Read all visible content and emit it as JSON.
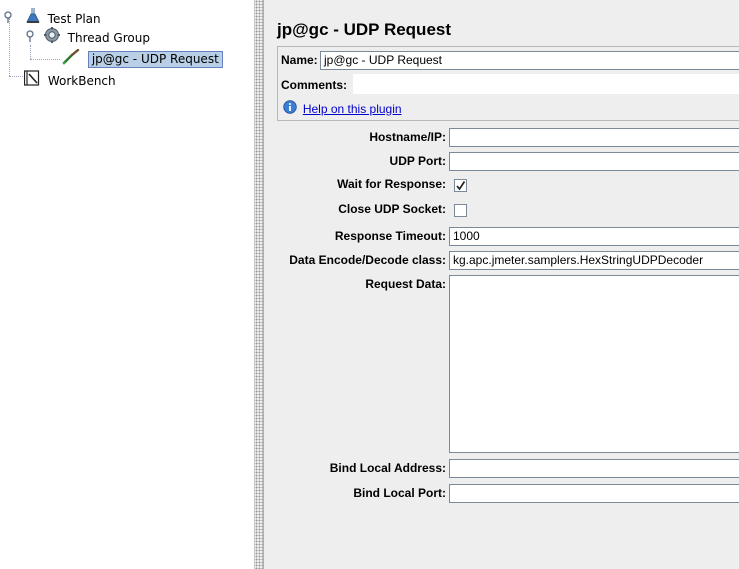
{
  "tree": {
    "items": [
      {
        "label": "Test Plan",
        "icon": "test-plan-flask-icon"
      },
      {
        "label": "Thread Group",
        "icon": "gear-icon"
      },
      {
        "label": "jp@gc - UDP Request",
        "icon": "dropper-sampler-icon"
      },
      {
        "label": "WorkBench",
        "icon": "notebook-icon"
      }
    ]
  },
  "panel": {
    "title": "jp@gc - UDP Request",
    "name_label": "Name:",
    "name_value": "jp@gc - UDP Request",
    "comments_label": "Comments:",
    "help_link": "Help on this plugin",
    "fields": {
      "hostname_label": "Hostname/IP:",
      "hostname_value": "",
      "udp_port_label": "UDP Port:",
      "udp_port_value": "",
      "wait_label": "Wait for Response:",
      "wait_checked": true,
      "close_label": "Close UDP Socket:",
      "close_checked": false,
      "timeout_label": "Response Timeout:",
      "timeout_value": "1000",
      "encode_label": "Data Encode/Decode class:",
      "encode_value": "kg.apc.jmeter.samplers.HexStringUDPDecoder",
      "request_label": "Request Data:",
      "request_value": "",
      "bind_addr_label": "Bind Local Address:",
      "bind_addr_value": "",
      "bind_port_label": "Bind Local Port:",
      "bind_port_value": ""
    }
  }
}
